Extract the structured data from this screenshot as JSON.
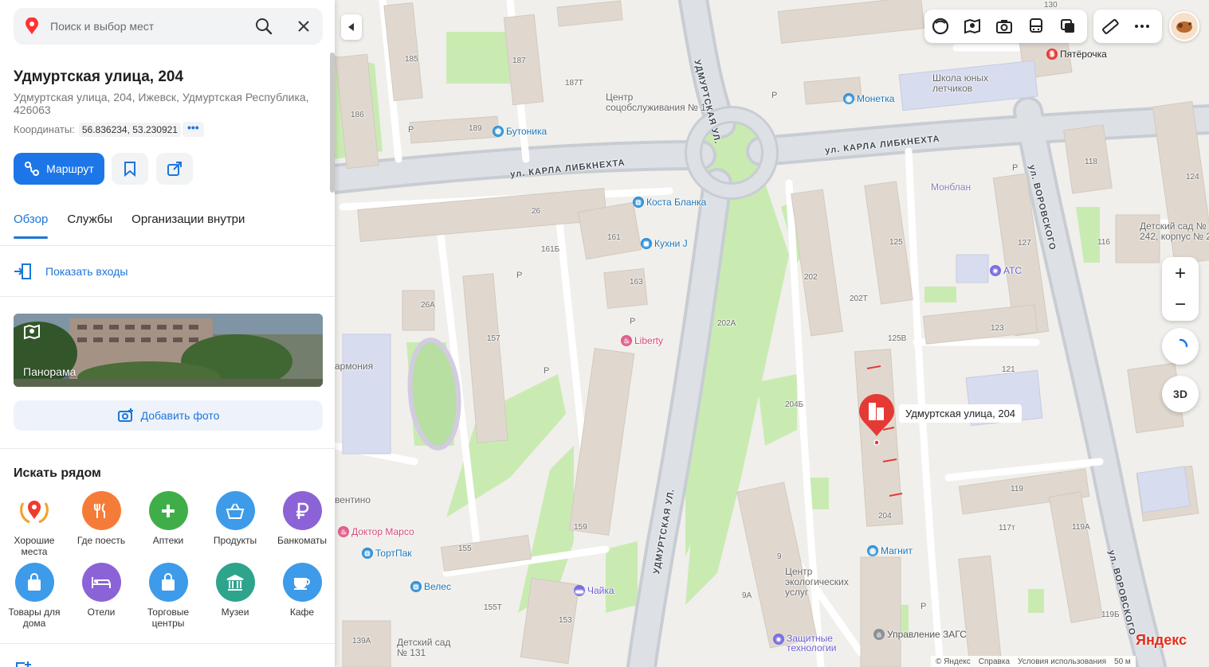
{
  "search": {
    "placeholder": "Поиск и выбор мест"
  },
  "place": {
    "title": "Удмуртская улица, 204",
    "address": "Удмуртская улица, 204, Ижевск, Удмуртская Республика, 426063",
    "coords_label": "Координаты:",
    "coords_value": "56.836234, 53.230921",
    "coords_more": "•••"
  },
  "actions": {
    "route": "Маршрут"
  },
  "tabs": [
    {
      "label": "Обзор",
      "active": true
    },
    {
      "label": "Службы"
    },
    {
      "label": "Организации внутри"
    }
  ],
  "entries": {
    "label": "Показать входы"
  },
  "panorama": {
    "label": "Панорама"
  },
  "add_photo": {
    "label": "Добавить фото"
  },
  "nearby": {
    "title": "Искать рядом",
    "categories": [
      {
        "label": "Хорошие места",
        "icon": "pin-laurel-icon",
        "color": "#ffffff"
      },
      {
        "label": "Где поесть",
        "icon": "fork-knife-icon",
        "color": "#f57c38"
      },
      {
        "label": "Аптеки",
        "icon": "plus-icon",
        "color": "#3fae49"
      },
      {
        "label": "Продукты",
        "icon": "basket-icon",
        "color": "#3d9be9"
      },
      {
        "label": "Банкоматы",
        "icon": "ruble-icon",
        "color": "#8b63d6"
      },
      {
        "label": "Товары для дома",
        "icon": "bag-icon",
        "color": "#3d9be9"
      },
      {
        "label": "Отели",
        "icon": "bed-icon",
        "color": "#8b63d6"
      },
      {
        "label": "Торговые центры",
        "icon": "bag-icon",
        "color": "#3d9be9"
      },
      {
        "label": "Музеи",
        "icon": "museum-icon",
        "color": "#2fa48d"
      },
      {
        "label": "Кафе",
        "icon": "cup-icon",
        "color": "#3d9be9"
      }
    ]
  },
  "map": {
    "marker_label": "Удмуртская улица, 204",
    "roads": [
      {
        "label": "ул. КАРЛА ЛИБКНЕХТА"
      },
      {
        "label": "ул. КАРЛА ЛИБКНЕХТА"
      },
      {
        "label": "УДМУРТСКАЯ УЛ."
      },
      {
        "label": "УДМУРТСКАЯ УЛ."
      },
      {
        "label": "ул. ВОРОВСКОГО"
      },
      {
        "label": "ул. ВОРОВСКОГО"
      }
    ],
    "pois": [
      {
        "label": "Бутоника",
        "kind": "blue"
      },
      {
        "label": "Монетка",
        "kind": "blue"
      },
      {
        "label": "Пятёрочка",
        "kind": "red"
      },
      {
        "label": "Коста Бланка",
        "kind": "blue"
      },
      {
        "label": "Кухни J",
        "kind": "blue"
      },
      {
        "label": "АТС",
        "kind": "violet"
      },
      {
        "label": "Liberty",
        "kind": "pink"
      },
      {
        "label": "Доктор Марсо",
        "kind": "pink"
      },
      {
        "label": "ТортПак",
        "kind": "blue"
      },
      {
        "label": "Велес",
        "kind": "blue"
      },
      {
        "label": "Чайка",
        "kind": "violet"
      },
      {
        "label": "Магнит",
        "kind": "blue"
      },
      {
        "label": "Защитные технологии",
        "kind": "violet"
      },
      {
        "label": "Управление ЗАГС",
        "kind": "grey"
      }
    ],
    "labels": [
      "Центр соцобслуживания № 1",
      "Школа юных летчиков",
      "Монблан",
      "Детский сад № 242, корпус № 2",
      "Центр экологических услуг",
      "Детский сад № 131",
      "армония",
      "вентино"
    ],
    "house_numbers": [
      "185",
      "187",
      "187Т",
      "186",
      "189",
      "26",
      "161",
      "161Б",
      "163",
      "157",
      "26А",
      "159",
      "155",
      "155Т",
      "153",
      "139А",
      "202",
      "202Т",
      "202А",
      "125",
      "125В",
      "123",
      "127",
      "118",
      "116",
      "124",
      "121",
      "204Б",
      "204",
      "119",
      "117т",
      "119А",
      "119Б",
      "9",
      "9А",
      "130",
      "Р"
    ],
    "footer": [
      "© Яндекс",
      "Справка",
      "Условия использования",
      "50 м"
    ],
    "logo": "Яндекс",
    "controls": {
      "zoom_in": "+",
      "zoom_out": "−",
      "view3d": "3D"
    }
  }
}
